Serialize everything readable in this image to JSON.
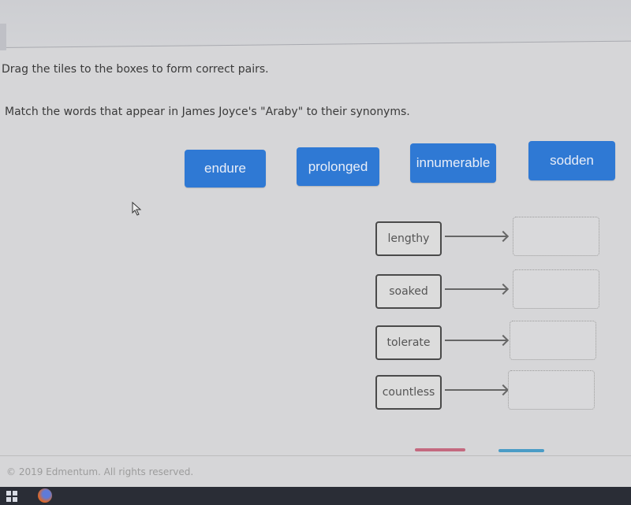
{
  "instructions": "Drag the tiles to the boxes to form correct pairs.",
  "prompt": "Match the words that appear in James Joyce's \"Araby\" to their synonyms.",
  "tiles": [
    {
      "label": "endure"
    },
    {
      "label": "prolonged"
    },
    {
      "label": "innumerable"
    },
    {
      "label": "sodden"
    }
  ],
  "pairs": [
    {
      "term": "lengthy",
      "answer": ""
    },
    {
      "term": "soaked",
      "answer": ""
    },
    {
      "term": "tolerate",
      "answer": ""
    },
    {
      "term": "countless",
      "answer": ""
    }
  ],
  "colors": {
    "tile_bg": "#2f79d4",
    "reset_accent": "#c4697f",
    "next_accent": "#4a9cc6"
  },
  "footer": "© 2019 Edmentum. All rights reserved."
}
